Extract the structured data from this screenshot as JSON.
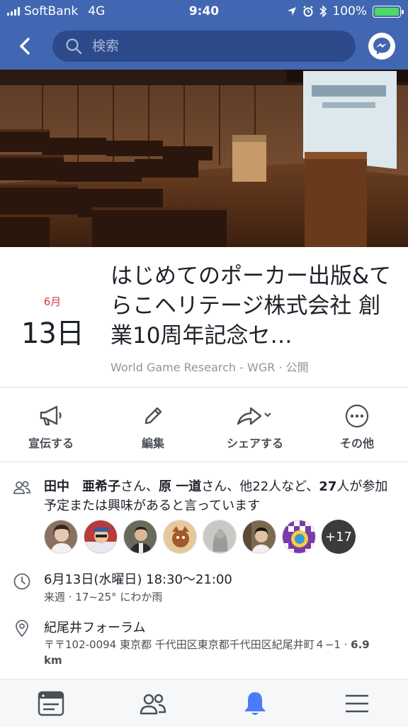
{
  "status_bar": {
    "carrier": "SoftBank",
    "network": "4G",
    "time": "9:40",
    "battery_percent": "100%",
    "battery_level": 1.0
  },
  "nav": {
    "search_placeholder": "検索"
  },
  "event": {
    "month": "6月",
    "day": "13日",
    "title": "はじめてのポーカー出版&てらこヘリテージ株式会社 創業10周年記念セ…",
    "host_line": "World Game Research - WGR · 公開"
  },
  "actions": [
    {
      "label": "宣伝する",
      "icon": "megaphone-icon"
    },
    {
      "label": "編集",
      "icon": "pencil-icon"
    },
    {
      "label": "シェアする",
      "icon": "share-icon"
    },
    {
      "label": "その他",
      "icon": "more-icon"
    }
  ],
  "going": {
    "name1": "田中　亜希子",
    "suffix1": "さん、",
    "name2": "原 一道",
    "suffix2": "さん、他22人など、",
    "count": "27",
    "suffix3": "人が参加予定または興味があると言っています",
    "more_count": "+17"
  },
  "time": {
    "main": "6月13日(水曜日) 18:30〜21:00",
    "sub": "来週 · 17~25° にわか雨"
  },
  "place": {
    "name": "紀尾井フォーラム",
    "address": "〒〒102-0094 東京都 千代田区東京都千代田区紀尾井町４−1 · ",
    "distance": "6.9 km"
  },
  "colors": {
    "brand": "#4267b2",
    "date_red": "#e0393e",
    "active_tab": "#4a7cf7"
  },
  "tabs": [
    "news-feed-icon",
    "friends-icon",
    "notifications-icon",
    "menu-icon"
  ]
}
